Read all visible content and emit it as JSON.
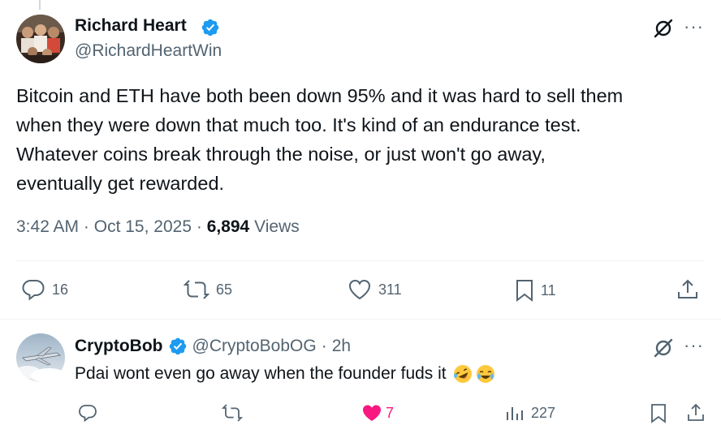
{
  "main_tweet": {
    "author_name": "Richard Heart",
    "author_handle": "@RichardHeartWin",
    "text_lines": [
      "Bitcoin and ETH have both been down 95% and it was hard to sell them",
      "when they were down that much too. It's kind of an endurance test.",
      "Whatever coins break through the noise, or just won't go away,",
      "eventually get rewarded."
    ],
    "time": "3:42 AM",
    "separator": "·",
    "date": "Oct 15, 2025",
    "views_count": "6,894",
    "views_label": "Views",
    "more": "···",
    "actions": {
      "replies": "16",
      "reposts": "65",
      "likes": "311",
      "bookmarks": "11"
    }
  },
  "reply": {
    "author_name": "CryptoBob",
    "author_handle": "@CryptoBobOG",
    "separator": "·",
    "time": "2h",
    "text": "Pdai wont even go away when the founder fuds it",
    "more": "···",
    "actions": {
      "likes": "7",
      "views": "227"
    }
  },
  "icons": {
    "verified": "verified-badge-icon",
    "grok": "grok-icon",
    "more": "more-options-icon",
    "reply": "reply-icon",
    "repost": "repost-icon",
    "like": "heart-icon",
    "bookmark": "bookmark-icon",
    "share": "share-icon",
    "views": "views-chart-icon",
    "emoji_rofl": "rolling-laughing-emoji",
    "emoji_joy": "tears-of-joy-emoji"
  },
  "colors": {
    "verified": "#1d9bf0",
    "like_active": "#f91880",
    "text_primary": "#0f1419",
    "text_secondary": "#536471",
    "divider": "#eff3f4"
  }
}
